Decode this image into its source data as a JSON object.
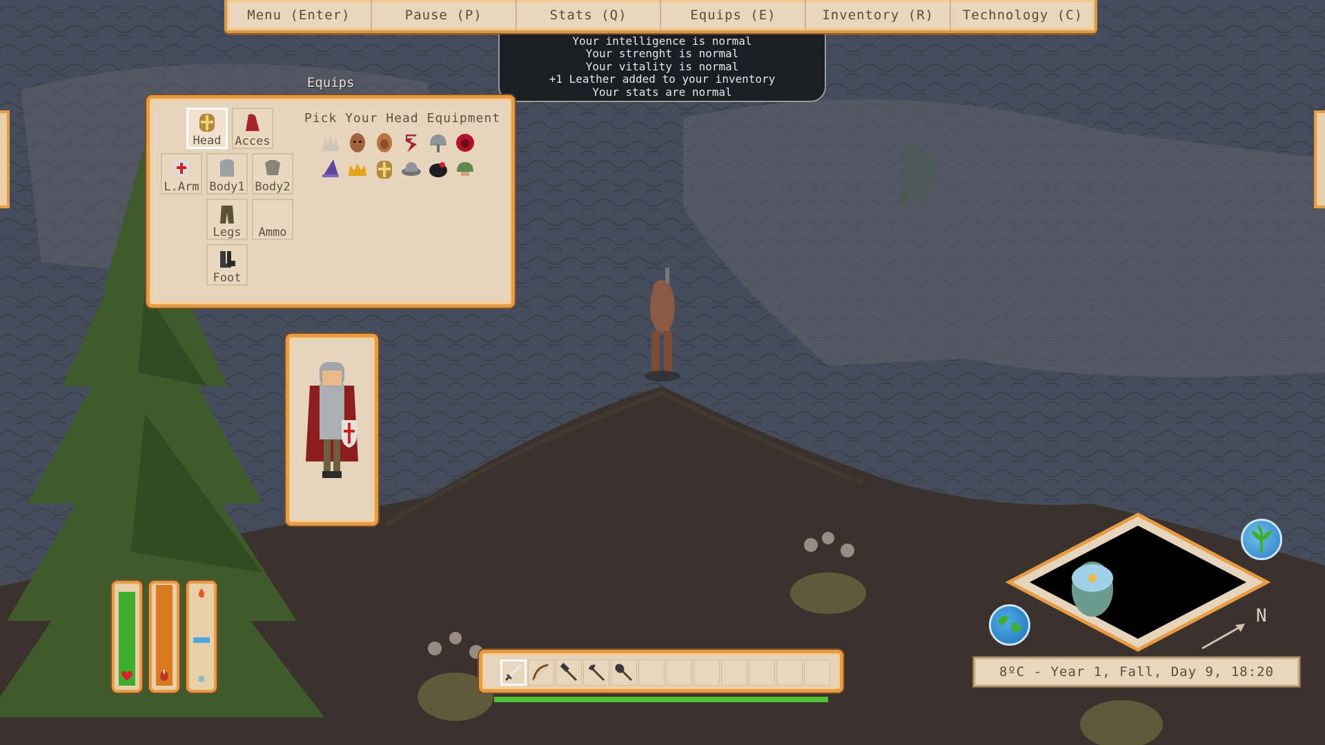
{
  "menu": {
    "tabs": [
      {
        "label": "Menu (Enter)"
      },
      {
        "label": "Pause (P)"
      },
      {
        "label": "Stats (Q)"
      },
      {
        "label": "Equips (E)"
      },
      {
        "label": "Inventory (R)"
      },
      {
        "label": "Technology (C)"
      }
    ]
  },
  "messages": [
    "Your intelligence is normal",
    "Your strenght is normal",
    "Your vitality is normal",
    "+1 Leather added to your inventory",
    "Your stats are normal"
  ],
  "equips": {
    "title": "Equips",
    "pick_title": "Pick Your Head Equipment",
    "slots": {
      "head": "Head",
      "acces": "Acces",
      "larm": "L.Arm",
      "body1": "Body1",
      "body2": "Body2",
      "legs": "Legs",
      "ammo": "Ammo",
      "foot": "Foot"
    },
    "head_options": [
      "horned-crown-icon",
      "leather-mask-icon",
      "leather-hood-icon",
      "ribbon-icon",
      "round-iron-helm-icon",
      "red-hood-icon",
      "wizard-hat-icon",
      "gold-crown-icon",
      "crusader-helm-icon",
      "kettle-helm-icon",
      "black-pot-helm-icon",
      "green-cap-icon"
    ],
    "selected_slot": "head"
  },
  "status": {
    "health": 0.88,
    "hunger": 0.98,
    "temperature": 0.45,
    "colors": {
      "health": "#3fae2e",
      "hunger": "#d97a1e",
      "cold": "#4aa8e0"
    }
  },
  "hotbar": {
    "items": [
      "sword-icon",
      "bow-icon",
      "hammer-icon",
      "axe-icon",
      "shovel-icon",
      "",
      "",
      "",
      "",
      "",
      "",
      ""
    ],
    "selected": 0,
    "xp": 1.0
  },
  "world": {
    "date_text": "8ºC - Year 1, Fall, Day 9, 18:20",
    "compass_label": "N"
  }
}
